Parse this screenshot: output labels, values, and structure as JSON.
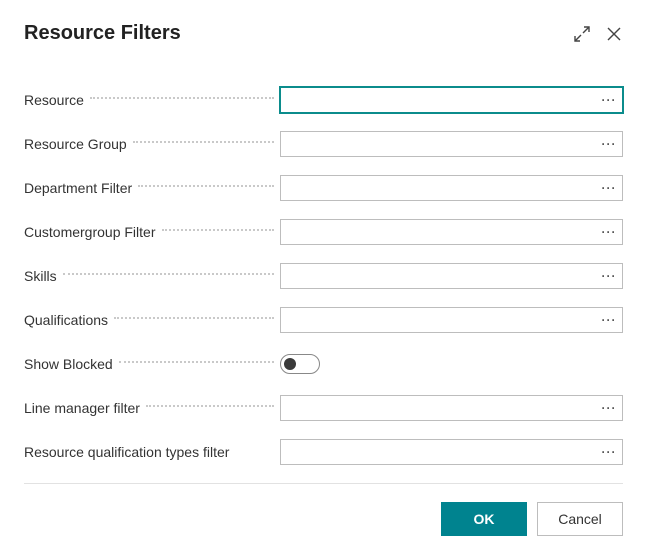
{
  "dialog": {
    "title": "Resource Filters"
  },
  "fields": {
    "resource": {
      "label": "Resource",
      "value": ""
    },
    "resourceGroup": {
      "label": "Resource Group",
      "value": ""
    },
    "departmentFilter": {
      "label": "Department Filter",
      "value": ""
    },
    "customergroupFilter": {
      "label": "Customergroup Filter",
      "value": ""
    },
    "skills": {
      "label": "Skills",
      "value": ""
    },
    "qualifications": {
      "label": "Qualifications",
      "value": ""
    },
    "showBlocked": {
      "label": "Show Blocked",
      "value": false
    },
    "lineManagerFilter": {
      "label": "Line manager filter",
      "value": ""
    },
    "rqTypesFilter": {
      "label": "Resource qualification types filter",
      "value": ""
    }
  },
  "footer": {
    "ok": "OK",
    "cancel": "Cancel"
  },
  "glyphs": {
    "ellipsis": "···"
  }
}
